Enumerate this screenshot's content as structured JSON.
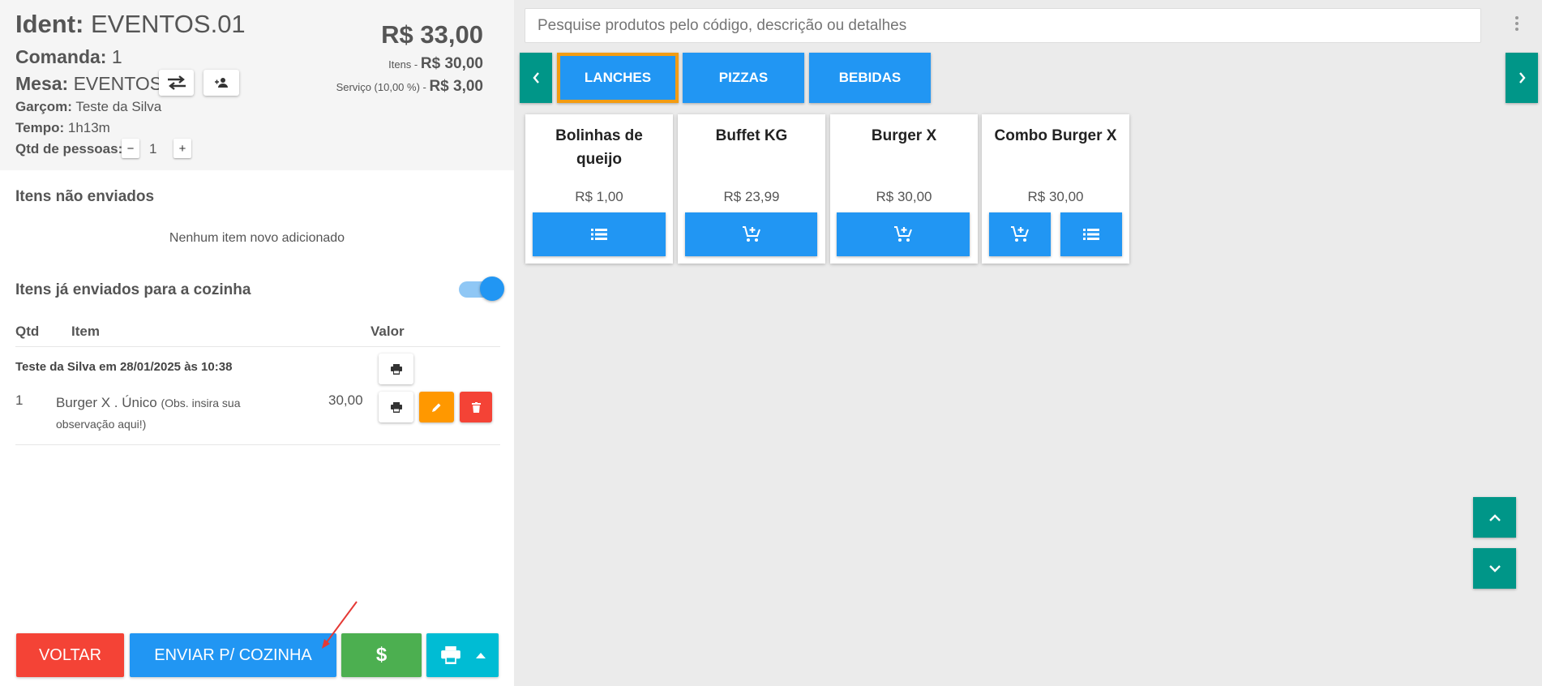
{
  "header": {
    "ident_label": "Ident:",
    "ident_value": "EVENTOS.01",
    "comanda_label": "Comanda:",
    "comanda_value": "1",
    "mesa_label": "Mesa:",
    "mesa_value": "EVENTOS",
    "garcom_label": "Garçom:",
    "garcom_value": "Teste da Silva",
    "tempo_label": "Tempo:",
    "tempo_value": "1h13m",
    "pessoas_label": "Qtd de pessoas:",
    "pessoas_value": "1",
    "minus": "−",
    "plus": "+"
  },
  "totals": {
    "total": "R$ 33,00",
    "itens_label": "Itens - ",
    "itens_value": "R$ 30,00",
    "servico_label": "Serviço (10,00 %) - ",
    "servico_value": "R$ 3,00"
  },
  "unsent": {
    "title": "Itens não enviados",
    "empty": "Nenhum item novo adicionado"
  },
  "sent": {
    "title": "Itens já enviados para a cozinha",
    "toggle_on": true,
    "columns": [
      "Qtd",
      "Item",
      "Valor"
    ],
    "group_label": "Teste da Silva em 28/01/2025 às 10:38",
    "rows": [
      {
        "qty": "1",
        "item": "Burger X . Único",
        "obs_line1": "(Obs. insira sua",
        "obs_line2": "observação aqui!)",
        "value": "30,00"
      }
    ]
  },
  "footer": {
    "back": "VOLTAR",
    "send": "ENVIAR P/ COZINHA",
    "pay_symbol": "$"
  },
  "search": {
    "placeholder": "Pesquise produtos pelo código, descrição ou detalhes"
  },
  "categories": [
    {
      "label": "LANCHES",
      "active": true
    },
    {
      "label": "PIZZAS",
      "active": false
    },
    {
      "label": "BEBIDAS",
      "active": false
    }
  ],
  "products": [
    {
      "name": "Bolinhas de queijo",
      "price": "R$ 1,00"
    },
    {
      "name": "Buffet KG",
      "price": "R$ 23,99"
    },
    {
      "name": "Burger X",
      "price": "R$ 30,00"
    },
    {
      "name": "Combo Burger X",
      "price": "R$ 30,00"
    }
  ],
  "icons": {
    "swap": "swap-icon",
    "add_person": "person-add-icon",
    "print": "printer-icon",
    "edit": "pencil-icon",
    "delete": "trash-icon",
    "list": "list-icon",
    "cart_add": "cart-add-icon",
    "chevron_left": "chevron-left-icon",
    "chevron_right": "chevron-right-icon",
    "chevron_up": "chevron-up-icon",
    "chevron_down": "chevron-down-icon",
    "caret_up": "caret-up-icon",
    "kebab": "more-vert-icon"
  },
  "colors": {
    "primary": "#2196f3",
    "teal": "#009688",
    "danger": "#f44336",
    "warning": "#ff9800",
    "success": "#4caf50",
    "cyan": "#00bcd4",
    "active_border": "#f39c12"
  }
}
